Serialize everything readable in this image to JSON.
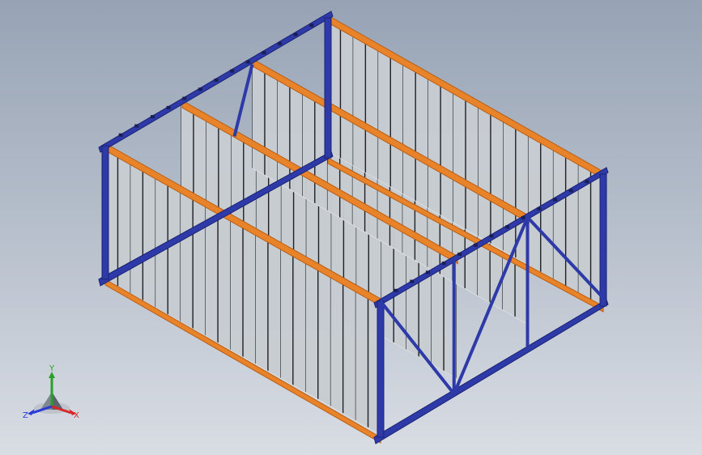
{
  "viewport": {
    "background_top": "#97a3b5",
    "background_bottom": "#d9dde4"
  },
  "model": {
    "frame_color": "#2d3aa8",
    "frame_dark": "#1b2373",
    "beam_color": "#e8832a",
    "beam_dark": "#b85e14",
    "panel_color": "#c8cdd2",
    "panel_light": "#dfe3e6",
    "rib_color": "#1e2226"
  },
  "triad": {
    "x_label": "X",
    "y_label": "Y",
    "z_label": "Z",
    "x_color": "#d62828",
    "y_color": "#2aa02a",
    "z_color": "#2a3ad6"
  }
}
